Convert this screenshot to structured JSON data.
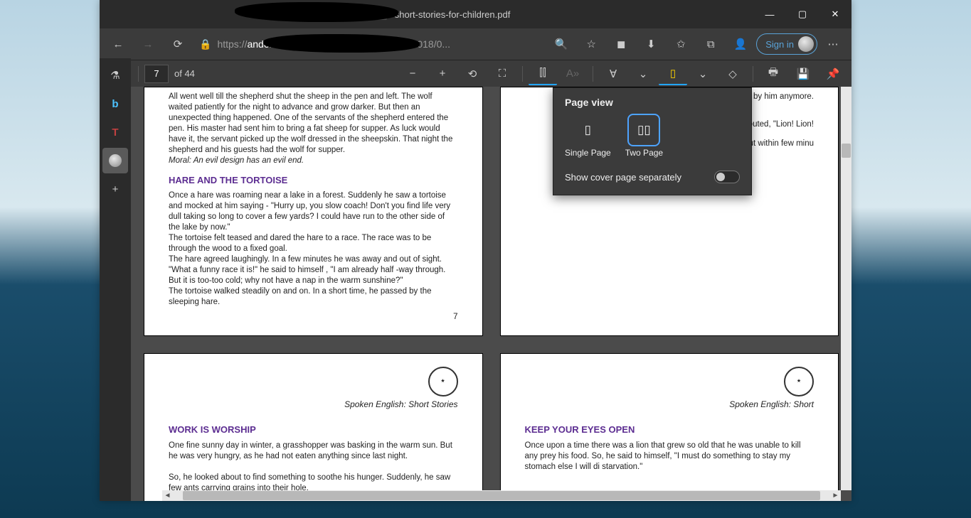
{
  "window": {
    "title": "*short-stories-for-children.pdf",
    "controls": {
      "minimize": "—",
      "maximize": "▢",
      "close": "✕"
    }
  },
  "nav": {
    "back": "←",
    "forward": "→",
    "refresh": "⟳",
    "lock": "🔒",
    "url_proto": "https://",
    "url_host": "andonovicmilica.files.wordpress.com",
    "url_path": "/2018/0...",
    "search": "🔍",
    "star": "☆",
    "extension": "◼",
    "download": "⬇",
    "favorites": "✩",
    "collections": "⧉",
    "persona": "👤",
    "signin": "Sign in",
    "more": "⋯"
  },
  "pdf": {
    "toc": "▤",
    "page_current": "7",
    "page_total": "of 44",
    "zoom_out": "−",
    "zoom_in": "+",
    "rotate": "⟲",
    "fit": "⛶",
    "pageview": "⫿⫿",
    "readaloud": "A»",
    "draw": "∀",
    "draw_more": "⌄",
    "highlight": "▯",
    "highlight_more": "⌄",
    "erase": "◇",
    "print": "🖶",
    "save": "💾",
    "pin": "📌"
  },
  "sidebar": {
    "flask": "⚗",
    "bing": "b",
    "translate": "T",
    "avatar": "👤",
    "add": "+"
  },
  "popover": {
    "title": "Page view",
    "single": "Single Page",
    "two": "Two Page",
    "cover": "Show cover page separately"
  },
  "pages": {
    "p7": {
      "para1": "All went well till the shepherd shut the sheep in the pen and left. The wolf waited patiently for the night to advance and grow darker. But then an unexpected thing happened. One of the servants of the shepherd entered the pen. His master had sent him to bring a fat sheep for supper. As luck would have it, the servant picked up the wolf dressed in the sheepskin. That night the shepherd and his guests had the wolf for supper.",
      "moral": "Moral: An evil design has an evil end.",
      "h": "HARE AND THE TORTOISE",
      "para2": "Once a hare was roaming near a lake in a forest. Suddenly he saw a tortoise and mocked at him saying - \"Hurry up, you slow coach! Don't you find life very dull taking so long to cover a few yards? I could have run to the other side of the lake by now.\"",
      "para3": "The tortoise felt teased and dared the hare to a race. The race was to be through the wood to a fixed goal.",
      "para4": "The hare agreed laughingly. In a few minutes he was away and out of sight.",
      "para5": "\"What a funny race it is!\" he said to himself , \"I am already half -way through. But it is too-too cold; why not have a nap in the warm sunshine?\"",
      "para6": "The tortoise walked steadily on and on. In a short time, he passed by the sleeping hare.",
      "num": "7"
    },
    "p8": {
      "frag1": "by him anymore.",
      "frag2": "w the boy shouted, \"Lion! Lion!",
      "frag3": "ave himself but within few minu"
    },
    "header": "Spoken English: Short Stories",
    "header_r": "Spoken English: Short",
    "p9": {
      "h": "WORK IS WORSHIP",
      "para1": "One fine sunny day in winter, a grasshopper was basking in the warm sun. But he was very hungry, as he had not eaten anything since last night.",
      "para2": "So, he looked about to find something to soothe his hunger. Suddenly, he saw few ants carrying grains into their hole."
    },
    "p10": {
      "h": "KEEP YOUR EYES OPEN",
      "para1": "Once upon a time there was a lion that grew so old that he was unable to kill any prey his food. So, he said to himself, \"I must do something to stay my stomach else I will di starvation.\""
    }
  }
}
